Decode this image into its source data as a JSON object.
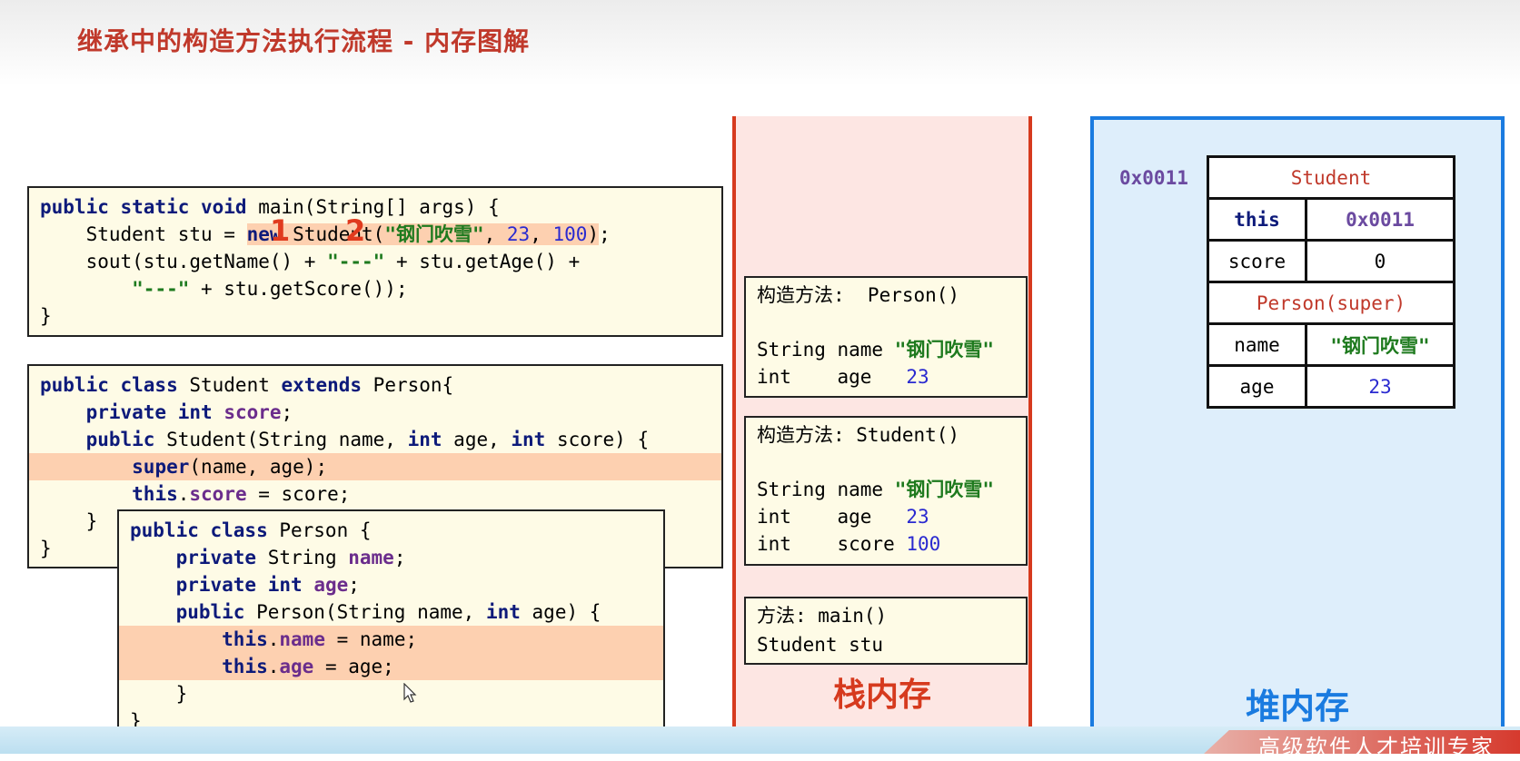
{
  "title": "继承中的构造方法执行流程 - 内存图解",
  "main_code": {
    "line1": "public static void main(String[] args) {",
    "line2_a": "    Student stu = ",
    "line2_b": "new Student(",
    "line2_c": "\"钢门吹雪\"",
    "line2_d": ", ",
    "line2_e": "23",
    "line2_f": ", ",
    "line2_g": "100",
    "line2_h": ");",
    "line3": "    sout(stu.getName() + \"---\" + stu.getAge() +",
    "line4": "        \"---\" + stu.getScore());",
    "line5": "}",
    "step1": "1",
    "step2": "2"
  },
  "student_code": {
    "l1": "public class Student extends Person{",
    "l2": "    private int score;",
    "l3": "    public Student(String name, int age, int score) {",
    "l4": "        super(name, age);",
    "l5": "        this.score = score;",
    "l6": "    }",
    "l7": "}"
  },
  "person_code": {
    "l1": "public class Person {",
    "l2": "    private String name;",
    "l3": "    private int age;",
    "l4": "    public Person(String name, int age) {",
    "l5": "        this.name = name;",
    "l6": "        this.age = age;",
    "l7": "    }",
    "l8": "}"
  },
  "stack": {
    "label": "栈内存",
    "frames": [
      {
        "title": "构造方法:  Person()",
        "rows": [
          "String name \"钢门吹雪\"",
          "int    age   23"
        ]
      },
      {
        "title": "构造方法: Student()",
        "rows": [
          "String name \"钢门吹雪\"",
          "int    age   23",
          "int    score 100"
        ]
      },
      {
        "title": "方法: main()",
        "rows": [
          "Student stu"
        ]
      }
    ]
  },
  "heap": {
    "label": "堆内存",
    "address": "0x0011",
    "object": {
      "class_name": "Student",
      "this_key": "this",
      "this_value": "0x0011",
      "score_key": "score",
      "score_value": "0",
      "super_label": "Person(super)",
      "name_key": "name",
      "name_value": "\"钢门吹雪\"",
      "age_key": "age",
      "age_value": "23"
    }
  },
  "brand": "高级软件人才培训专家"
}
